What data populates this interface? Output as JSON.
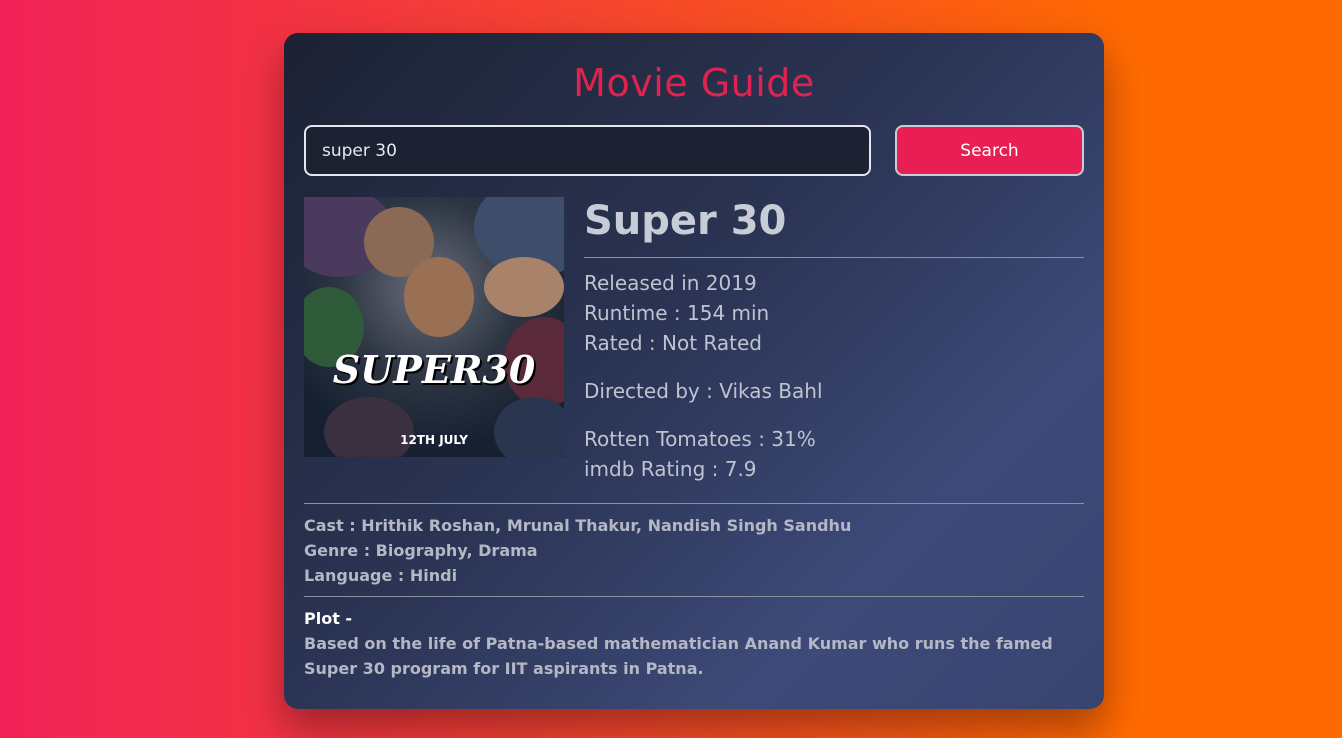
{
  "app": {
    "title": "Movie Guide"
  },
  "search": {
    "value": "super 30",
    "button_label": "Search"
  },
  "movie": {
    "title": "Super 30",
    "poster_title": "SUPER30",
    "poster_date": "12TH JULY",
    "released": "Released in 2019",
    "runtime": "Runtime : 154 min",
    "rated": "Rated : Not Rated",
    "director": "Directed by : Vikas Bahl",
    "rotten_tomatoes": "Rotten Tomatoes : 31%",
    "imdb": "imdb Rating : 7.9",
    "cast": "Cast : Hrithik Roshan, Mrunal Thakur, Nandish Singh Sandhu",
    "genre": "Genre : Biography, Drama",
    "language": "Language : Hindi",
    "plot_label": "Plot -",
    "plot": "Based on the life of Patna-based mathematician Anand Kumar who runs the famed Super 30 program for IIT aspirants in Patna."
  },
  "colors": {
    "accent": "#e0224e",
    "button": "#e91e55"
  }
}
